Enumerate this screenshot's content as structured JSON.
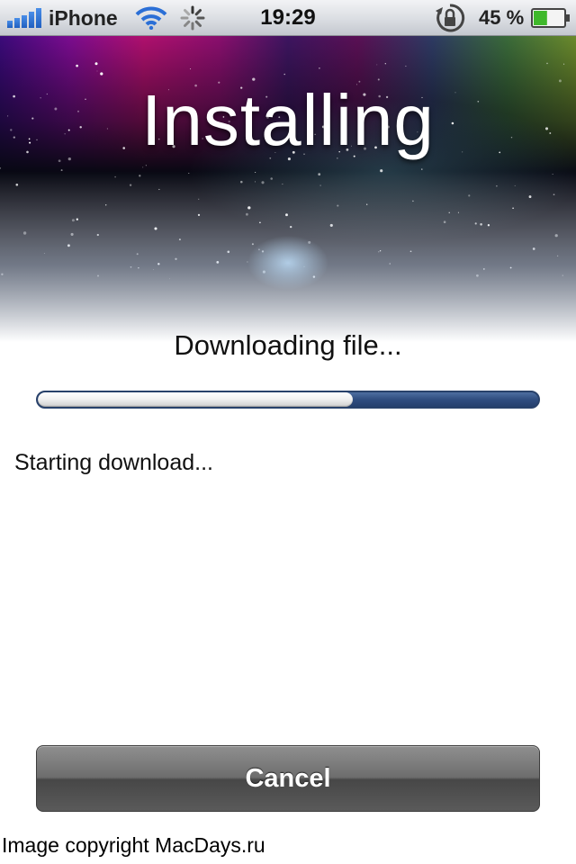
{
  "status_bar": {
    "carrier": "iPhone",
    "time": "19:29",
    "battery_percent": "45 %",
    "battery_level": 0.45,
    "icons": [
      "signal-bars-icon",
      "wifi-icon",
      "activity-spinner-icon",
      "rotation-lock-icon",
      "battery-icon"
    ]
  },
  "header": {
    "title": "Installing"
  },
  "main": {
    "status_label": "Downloading file...",
    "progress": 0.63,
    "log_text": "Starting download..."
  },
  "actions": {
    "cancel_label": "Cancel"
  },
  "footer": {
    "copyright": "Image copyright MacDays.ru"
  },
  "colors": {
    "progress_track": "#2f4d7f",
    "progress_fill": "#f1f1f1",
    "button": "#5a5a5a"
  }
}
